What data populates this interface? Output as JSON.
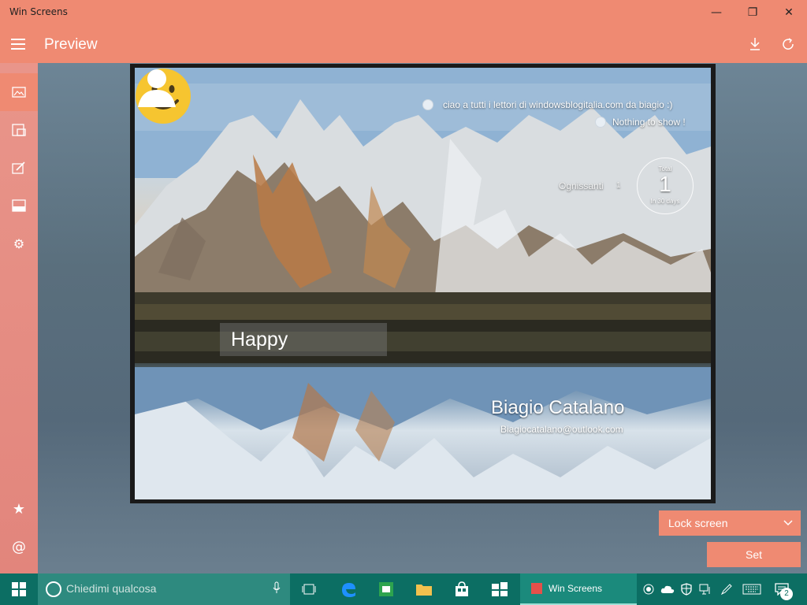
{
  "window": {
    "title": "Win Screens",
    "controls": {
      "minimize": "—",
      "maximize": "❐",
      "close": "✕"
    }
  },
  "appbar": {
    "title": "Preview",
    "download_icon": "download-icon",
    "refresh_icon": "refresh-icon"
  },
  "sidenav": {
    "items": [
      {
        "name": "image",
        "glyph": "▭"
      },
      {
        "name": "layout",
        "glyph": "▤"
      },
      {
        "name": "edit",
        "glyph": "✎"
      },
      {
        "name": "panel",
        "glyph": "▬"
      },
      {
        "name": "settings",
        "glyph": "⚙"
      },
      {
        "name": "favorites",
        "glyph": "★"
      },
      {
        "name": "contact",
        "glyph": "@"
      }
    ]
  },
  "preview": {
    "notifications": [
      "ciao a tutti i lettori di windowsblogitalia.com da biagio :)",
      "Nothing to show !"
    ],
    "calendar": {
      "event_name": "Ognissanti",
      "event_count": "1",
      "total_label": "Total",
      "total_value": "1",
      "range_label": "In 30 days"
    },
    "mood": "Happy",
    "user": {
      "name": "Biagio Catalano",
      "email": "Biagiocatalano@outlook.com"
    }
  },
  "controls": {
    "dropdown_value": "Lock screen",
    "set_label": "Set"
  },
  "taskbar": {
    "search_placeholder": "Chiedimi qualcosa",
    "active_app": "Win Screens",
    "notification_count": "2"
  },
  "colors": {
    "accent": "#ef8a72",
    "taskbar": "#0c6e63"
  }
}
